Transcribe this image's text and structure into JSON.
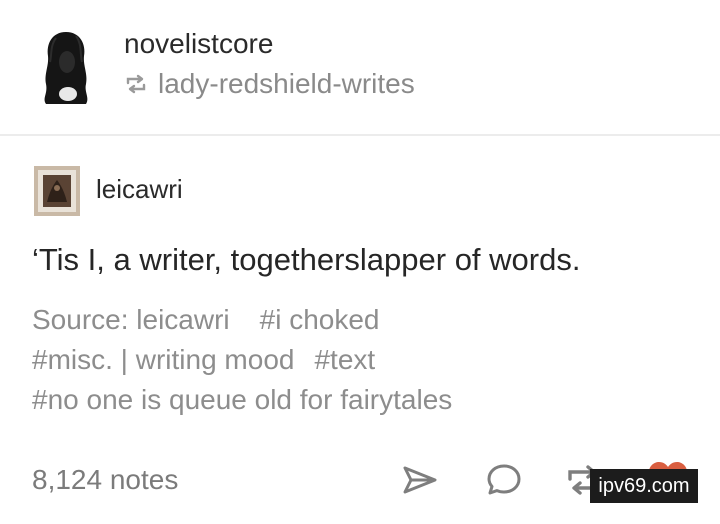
{
  "header": {
    "username": "novelistcore",
    "reblogged_from": "lady-redshield-writes",
    "avatar_icon": "silhouette-avatar",
    "reblog_icon": "reblog-icon"
  },
  "post": {
    "author": "leicawri",
    "author_avatar_icon": "framed-picture-avatar",
    "body": "‘Tis I, a writer, togetherslapper of words.",
    "source_label": "Source: leicawri",
    "tags": [
      "#i choked",
      "#misc. | writing mood",
      "#text",
      "#no one is queue old for fairytales"
    ]
  },
  "footer": {
    "notes": "8,124 notes",
    "actions": {
      "share": "share-icon",
      "reply": "reply-icon",
      "reblog": "reblog-icon",
      "like": "heart-icon"
    }
  },
  "watermark": "ipv69.com",
  "colors": {
    "text_primary": "#262626",
    "text_muted": "#8d8d8d",
    "divider": "#ececec",
    "like": "#d95e40"
  }
}
